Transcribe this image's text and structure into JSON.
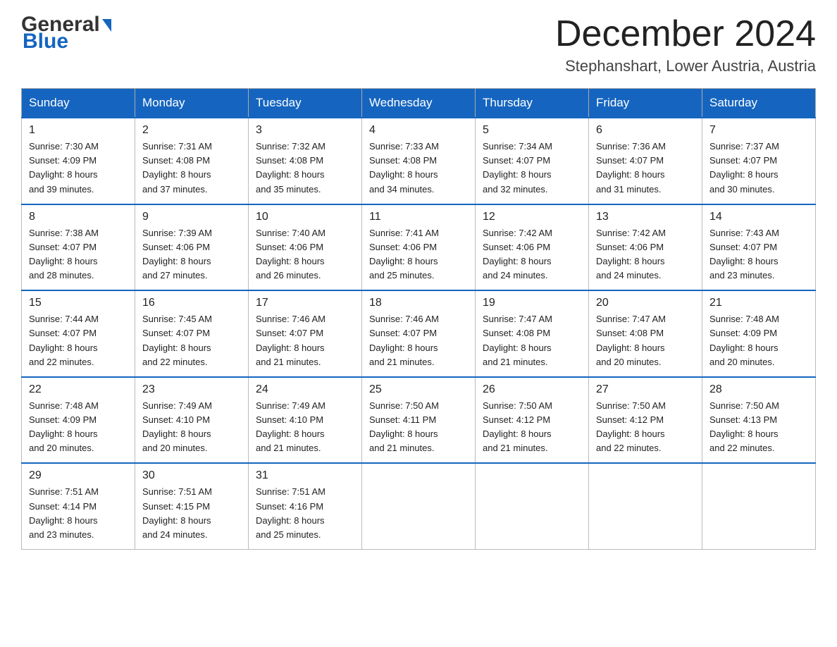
{
  "header": {
    "logo_general": "General",
    "logo_blue": "Blue",
    "month_title": "December 2024",
    "location": "Stephanshart, Lower Austria, Austria"
  },
  "days_of_week": [
    "Sunday",
    "Monday",
    "Tuesday",
    "Wednesday",
    "Thursday",
    "Friday",
    "Saturday"
  ],
  "weeks": [
    [
      {
        "day": "1",
        "sunrise": "Sunrise: 7:30 AM",
        "sunset": "Sunset: 4:09 PM",
        "daylight": "Daylight: 8 hours",
        "daylight2": "and 39 minutes."
      },
      {
        "day": "2",
        "sunrise": "Sunrise: 7:31 AM",
        "sunset": "Sunset: 4:08 PM",
        "daylight": "Daylight: 8 hours",
        "daylight2": "and 37 minutes."
      },
      {
        "day": "3",
        "sunrise": "Sunrise: 7:32 AM",
        "sunset": "Sunset: 4:08 PM",
        "daylight": "Daylight: 8 hours",
        "daylight2": "and 35 minutes."
      },
      {
        "day": "4",
        "sunrise": "Sunrise: 7:33 AM",
        "sunset": "Sunset: 4:08 PM",
        "daylight": "Daylight: 8 hours",
        "daylight2": "and 34 minutes."
      },
      {
        "day": "5",
        "sunrise": "Sunrise: 7:34 AM",
        "sunset": "Sunset: 4:07 PM",
        "daylight": "Daylight: 8 hours",
        "daylight2": "and 32 minutes."
      },
      {
        "day": "6",
        "sunrise": "Sunrise: 7:36 AM",
        "sunset": "Sunset: 4:07 PM",
        "daylight": "Daylight: 8 hours",
        "daylight2": "and 31 minutes."
      },
      {
        "day": "7",
        "sunrise": "Sunrise: 7:37 AM",
        "sunset": "Sunset: 4:07 PM",
        "daylight": "Daylight: 8 hours",
        "daylight2": "and 30 minutes."
      }
    ],
    [
      {
        "day": "8",
        "sunrise": "Sunrise: 7:38 AM",
        "sunset": "Sunset: 4:07 PM",
        "daylight": "Daylight: 8 hours",
        "daylight2": "and 28 minutes."
      },
      {
        "day": "9",
        "sunrise": "Sunrise: 7:39 AM",
        "sunset": "Sunset: 4:06 PM",
        "daylight": "Daylight: 8 hours",
        "daylight2": "and 27 minutes."
      },
      {
        "day": "10",
        "sunrise": "Sunrise: 7:40 AM",
        "sunset": "Sunset: 4:06 PM",
        "daylight": "Daylight: 8 hours",
        "daylight2": "and 26 minutes."
      },
      {
        "day": "11",
        "sunrise": "Sunrise: 7:41 AM",
        "sunset": "Sunset: 4:06 PM",
        "daylight": "Daylight: 8 hours",
        "daylight2": "and 25 minutes."
      },
      {
        "day": "12",
        "sunrise": "Sunrise: 7:42 AM",
        "sunset": "Sunset: 4:06 PM",
        "daylight": "Daylight: 8 hours",
        "daylight2": "and 24 minutes."
      },
      {
        "day": "13",
        "sunrise": "Sunrise: 7:42 AM",
        "sunset": "Sunset: 4:06 PM",
        "daylight": "Daylight: 8 hours",
        "daylight2": "and 24 minutes."
      },
      {
        "day": "14",
        "sunrise": "Sunrise: 7:43 AM",
        "sunset": "Sunset: 4:07 PM",
        "daylight": "Daylight: 8 hours",
        "daylight2": "and 23 minutes."
      }
    ],
    [
      {
        "day": "15",
        "sunrise": "Sunrise: 7:44 AM",
        "sunset": "Sunset: 4:07 PM",
        "daylight": "Daylight: 8 hours",
        "daylight2": "and 22 minutes."
      },
      {
        "day": "16",
        "sunrise": "Sunrise: 7:45 AM",
        "sunset": "Sunset: 4:07 PM",
        "daylight": "Daylight: 8 hours",
        "daylight2": "and 22 minutes."
      },
      {
        "day": "17",
        "sunrise": "Sunrise: 7:46 AM",
        "sunset": "Sunset: 4:07 PM",
        "daylight": "Daylight: 8 hours",
        "daylight2": "and 21 minutes."
      },
      {
        "day": "18",
        "sunrise": "Sunrise: 7:46 AM",
        "sunset": "Sunset: 4:07 PM",
        "daylight": "Daylight: 8 hours",
        "daylight2": "and 21 minutes."
      },
      {
        "day": "19",
        "sunrise": "Sunrise: 7:47 AM",
        "sunset": "Sunset: 4:08 PM",
        "daylight": "Daylight: 8 hours",
        "daylight2": "and 21 minutes."
      },
      {
        "day": "20",
        "sunrise": "Sunrise: 7:47 AM",
        "sunset": "Sunset: 4:08 PM",
        "daylight": "Daylight: 8 hours",
        "daylight2": "and 20 minutes."
      },
      {
        "day": "21",
        "sunrise": "Sunrise: 7:48 AM",
        "sunset": "Sunset: 4:09 PM",
        "daylight": "Daylight: 8 hours",
        "daylight2": "and 20 minutes."
      }
    ],
    [
      {
        "day": "22",
        "sunrise": "Sunrise: 7:48 AM",
        "sunset": "Sunset: 4:09 PM",
        "daylight": "Daylight: 8 hours",
        "daylight2": "and 20 minutes."
      },
      {
        "day": "23",
        "sunrise": "Sunrise: 7:49 AM",
        "sunset": "Sunset: 4:10 PM",
        "daylight": "Daylight: 8 hours",
        "daylight2": "and 20 minutes."
      },
      {
        "day": "24",
        "sunrise": "Sunrise: 7:49 AM",
        "sunset": "Sunset: 4:10 PM",
        "daylight": "Daylight: 8 hours",
        "daylight2": "and 21 minutes."
      },
      {
        "day": "25",
        "sunrise": "Sunrise: 7:50 AM",
        "sunset": "Sunset: 4:11 PM",
        "daylight": "Daylight: 8 hours",
        "daylight2": "and 21 minutes."
      },
      {
        "day": "26",
        "sunrise": "Sunrise: 7:50 AM",
        "sunset": "Sunset: 4:12 PM",
        "daylight": "Daylight: 8 hours",
        "daylight2": "and 21 minutes."
      },
      {
        "day": "27",
        "sunrise": "Sunrise: 7:50 AM",
        "sunset": "Sunset: 4:12 PM",
        "daylight": "Daylight: 8 hours",
        "daylight2": "and 22 minutes."
      },
      {
        "day": "28",
        "sunrise": "Sunrise: 7:50 AM",
        "sunset": "Sunset: 4:13 PM",
        "daylight": "Daylight: 8 hours",
        "daylight2": "and 22 minutes."
      }
    ],
    [
      {
        "day": "29",
        "sunrise": "Sunrise: 7:51 AM",
        "sunset": "Sunset: 4:14 PM",
        "daylight": "Daylight: 8 hours",
        "daylight2": "and 23 minutes."
      },
      {
        "day": "30",
        "sunrise": "Sunrise: 7:51 AM",
        "sunset": "Sunset: 4:15 PM",
        "daylight": "Daylight: 8 hours",
        "daylight2": "and 24 minutes."
      },
      {
        "day": "31",
        "sunrise": "Sunrise: 7:51 AM",
        "sunset": "Sunset: 4:16 PM",
        "daylight": "Daylight: 8 hours",
        "daylight2": "and 25 minutes."
      },
      null,
      null,
      null,
      null
    ]
  ]
}
